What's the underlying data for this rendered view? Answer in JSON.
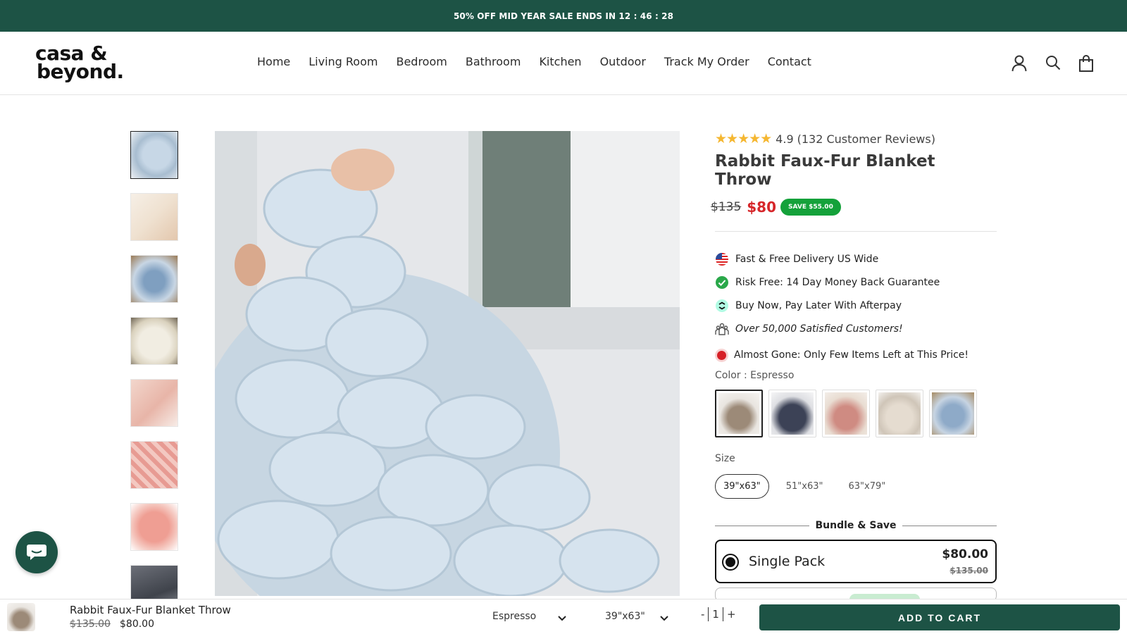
{
  "announcement": "50% OFF MID YEAR SALE ENDS IN 12 : 46 : 28",
  "logo": {
    "line1": "casa &",
    "line2": "beyond."
  },
  "nav": [
    "Home",
    "Living Room",
    "Bedroom",
    "Bathroom",
    "Kitchen",
    "Outdoor",
    "Track My Order",
    "Contact"
  ],
  "header_icons": [
    "account-icon",
    "search-icon",
    "cart-icon"
  ],
  "product": {
    "rating_value": "4.9",
    "rating_text": "(132 Customer Reviews)",
    "title": "Rabbit Faux-Fur Blanket Throw",
    "old_price": "$135",
    "new_price": "$80",
    "save_badge": "SAVE $55.00",
    "features": [
      {
        "icon": "us-flag-icon",
        "text": "Fast & Free Delivery US Wide"
      },
      {
        "icon": "check-circle-icon",
        "text": "Risk Free: 14 Day Money Back Guarantee"
      },
      {
        "icon": "afterpay-icon",
        "text": "Buy Now, Pay Later With Afterpay"
      },
      {
        "icon": "customers-icon",
        "text": "Over 50,000 Satisfied Customers!"
      }
    ],
    "stock": "Almost Gone: Only Few Items Left at This Price!",
    "color_label": "Color : Espresso",
    "size_label": "Size",
    "sizes": [
      "39\"x63\"",
      "51\"x63\"",
      "63\"x79\""
    ],
    "selected_size_index": 0,
    "bundle_heading": "Bundle & Save",
    "pack": {
      "name": "Single Pack",
      "price": "$80.00",
      "old": "$135.00"
    }
  },
  "colors": {
    "accent": "#1d5345",
    "sale_red": "#d6262a",
    "save_green": "#14a13a"
  },
  "sticky": {
    "title": "Rabbit Faux-Fur Blanket Throw",
    "old_price": "$135.00",
    "new_price": "$80.00",
    "color": "Espresso",
    "size": "39\"x63\"",
    "qty_minus": "-",
    "qty": "1",
    "qty_plus": "+",
    "add_to_cart": "ADD TO CART"
  }
}
